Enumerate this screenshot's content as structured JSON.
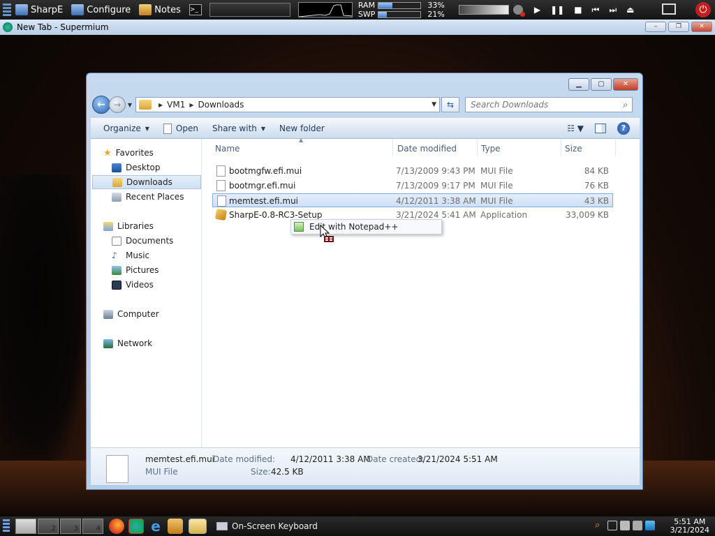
{
  "topbar": {
    "buttons": [
      {
        "label": "SharpE"
      },
      {
        "label": "Configure"
      },
      {
        "label": "Notes"
      }
    ],
    "meters": [
      {
        "label": "RAM",
        "percent": 33,
        "percent_text": "33%"
      },
      {
        "label": "SWP",
        "percent": 21,
        "percent_text": "21%"
      }
    ],
    "media": [
      "play",
      "pause",
      "stop",
      "prev",
      "next"
    ]
  },
  "browser": {
    "title": "New Tab - Supermium",
    "controls": {
      "minimize": "–",
      "maximize": "❐",
      "close": "✕"
    }
  },
  "explorer": {
    "breadcrumb": [
      "VM1",
      "Downloads"
    ],
    "search_placeholder": "Search Downloads",
    "commands": {
      "organize": "Organize",
      "open": "Open",
      "share_with": "Share with",
      "new_folder": "New folder"
    },
    "nav": {
      "favorites": "Favorites",
      "desktop": "Desktop",
      "downloads": "Downloads",
      "recent_places": "Recent Places",
      "libraries": "Libraries",
      "documents": "Documents",
      "music": "Music",
      "pictures": "Pictures",
      "videos": "Videos",
      "computer": "Computer",
      "network": "Network"
    },
    "columns": {
      "name": "Name",
      "date": "Date modified",
      "type": "Type",
      "size": "Size"
    },
    "files": [
      {
        "name": "bootmgfw.efi.mui",
        "date": "7/13/2009 9:43 PM",
        "type": "MUI File",
        "size": "84 KB"
      },
      {
        "name": "bootmgr.efi.mui",
        "date": "7/13/2009 9:17 PM",
        "type": "MUI File",
        "size": "76 KB"
      },
      {
        "name": "memtest.efi.mui",
        "date": "4/12/2011 3:38 AM",
        "type": "MUI File",
        "size": "43 KB"
      },
      {
        "name": "SharpE-0.8-RC3-Setup",
        "date": "3/21/2024 5:41 AM",
        "type": "Application",
        "size": "33,009 KB"
      }
    ],
    "context_menu": {
      "item": "Edit with Notepad++"
    },
    "details": {
      "name": "memtest.efi.mui",
      "type": "MUI File",
      "modified_label": "Date modified:",
      "modified_value": "4/12/2011 3:38 AM",
      "size_label": "Size:",
      "size_value": "42.5 KB",
      "created_label": "Date created:",
      "created_value": "3/21/2024 5:51 AM"
    }
  },
  "taskbar": {
    "desktops": [
      "",
      "2",
      "3",
      "4"
    ],
    "task_label": "On-Screen Keyboard",
    "clock_time": "5:51 AM",
    "clock_date": "3/21/2024"
  }
}
